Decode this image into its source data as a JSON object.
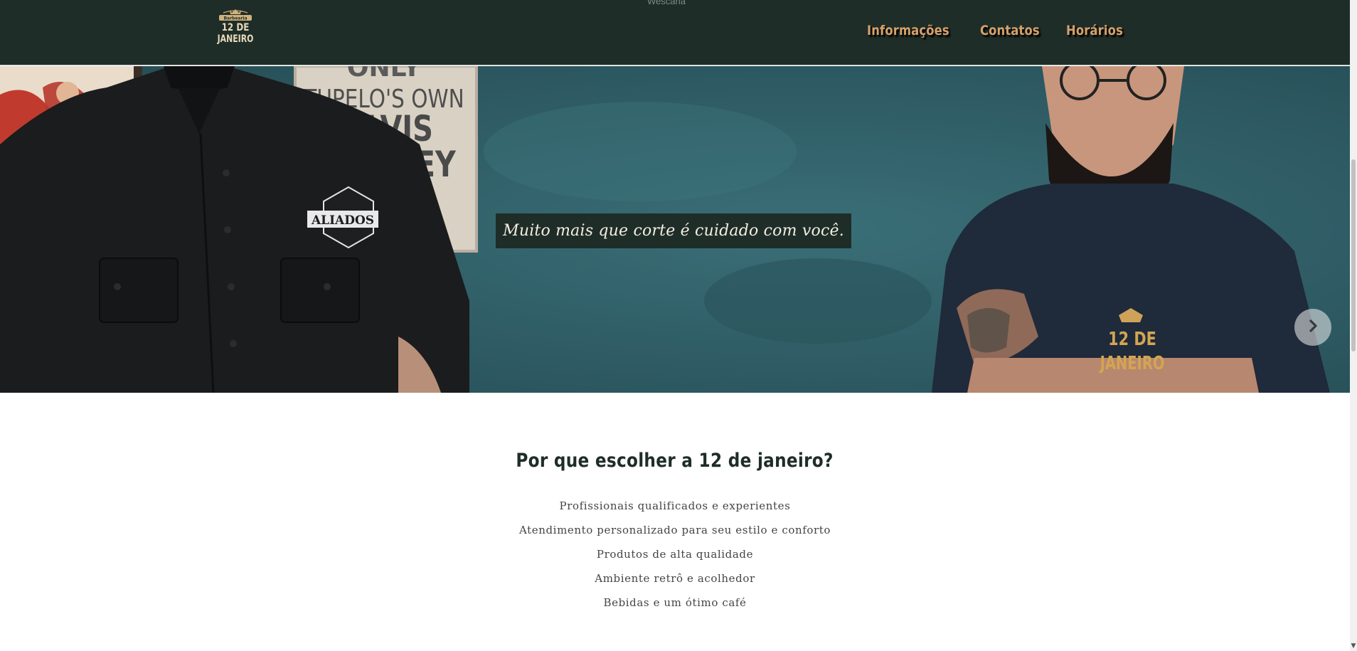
{
  "header": {
    "faint_text": "Wescana",
    "logo": {
      "top_text": "Barbearia",
      "line1": "12 DE",
      "line2": "JANEIRO"
    },
    "nav": [
      {
        "label": "Informações"
      },
      {
        "label": "Contatos"
      },
      {
        "label": "Horários"
      }
    ]
  },
  "hero": {
    "caption": "Muito mais que corte é cuidado com você.",
    "poster_lines": [
      "ONLY",
      "TUPELO'S OWN",
      "ELVIS",
      "LEY"
    ],
    "shirt_badge": "ALIADOS",
    "shirt_logo_lines": [
      "12 DE",
      "JANEIRO"
    ],
    "next_icon": "chevron-right-icon"
  },
  "features": {
    "title": "Por que escolher a 12 de janeiro?",
    "items": [
      "Profissionais qualificados e experientes",
      "Atendimento personalizado para seu estilo e conforto",
      "Produtos de alta qualidade",
      "Ambiente retrô e acolhedor",
      "Bebidas e um ótimo café"
    ]
  },
  "colors": {
    "header_bg": "#1f2d28",
    "nav_text": "#d6a26a",
    "hero_wall": "#2f5c65",
    "caption_bg": "#1f2d28",
    "caption_text": "#f3ede2",
    "title_text": "#1f2d28",
    "body_text": "#444444"
  }
}
